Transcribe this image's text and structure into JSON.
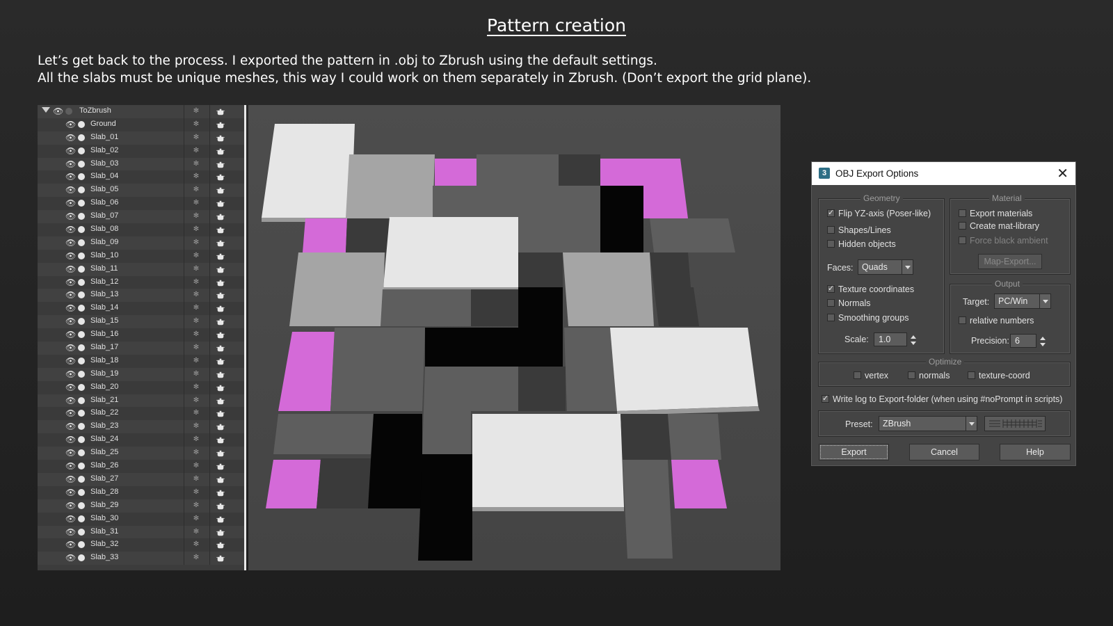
{
  "slide": {
    "title": "Pattern creation",
    "line1": "Let’s get back to the process. I exported the pattern in .obj to Zbrush using the default settings.",
    "line2": "All the slabs must be unique meshes, this way I could work on them separately in Zbrush. (Don’t export the grid plane)."
  },
  "outliner": {
    "root": "ToZbrush",
    "items": [
      "Ground",
      "Slab_01",
      "Slab_02",
      "Slab_03",
      "Slab_04",
      "Slab_05",
      "Slab_06",
      "Slab_07",
      "Slab_08",
      "Slab_09",
      "Slab_10",
      "Slab_11",
      "Slab_12",
      "Slab_13",
      "Slab_14",
      "Slab_15",
      "Slab_16",
      "Slab_17",
      "Slab_18",
      "Slab_19",
      "Slab_20",
      "Slab_21",
      "Slab_22",
      "Slab_23",
      "Slab_24",
      "Slab_25",
      "Slab_26",
      "Slab_27",
      "Slab_28",
      "Slab_29",
      "Slab_30",
      "Slab_31",
      "Slab_32",
      "Slab_33"
    ]
  },
  "dialog": {
    "app_icon": "3",
    "title": "OBJ Export Options",
    "close_glyph": "✕",
    "geometry": {
      "label": "Geometry",
      "flip_yz": "Flip YZ-axis (Poser-like)",
      "shapes_lines": "Shapes/Lines",
      "hidden_objects": "Hidden objects",
      "faces_label": "Faces:",
      "faces_value": "Quads",
      "texture_coords": "Texture coordinates",
      "normals": "Normals",
      "smoothing_groups": "Smoothing groups",
      "scale_label": "Scale:",
      "scale_value": "1.0"
    },
    "material": {
      "label": "Material",
      "export_materials": "Export materials",
      "create_mat_library": "Create mat-library",
      "force_black_ambient": "Force black ambient",
      "map_export": "Map-Export..."
    },
    "output": {
      "label": "Output",
      "target_label": "Target:",
      "target_value": "PC/Win",
      "relative_numbers": "relative numbers",
      "precision_label": "Precision:",
      "precision_value": "6"
    },
    "optimize": {
      "label": "Optimize",
      "vertex": "vertex",
      "normals": "normals",
      "texture_coord": "texture-coord"
    },
    "write_log": "Write log to Export-folder (when using #noPrompt in scripts)",
    "preset_label": "Preset:",
    "preset_value": "ZBrush",
    "export": "Export",
    "cancel": "Cancel",
    "help": "Help"
  },
  "colors": {
    "magenta": "#d46ad8",
    "light": "#e6e6e6",
    "mid": "#a5a5a5",
    "dark": "#5e5e5e",
    "darker": "#3a3a3a",
    "black": "#050505"
  }
}
